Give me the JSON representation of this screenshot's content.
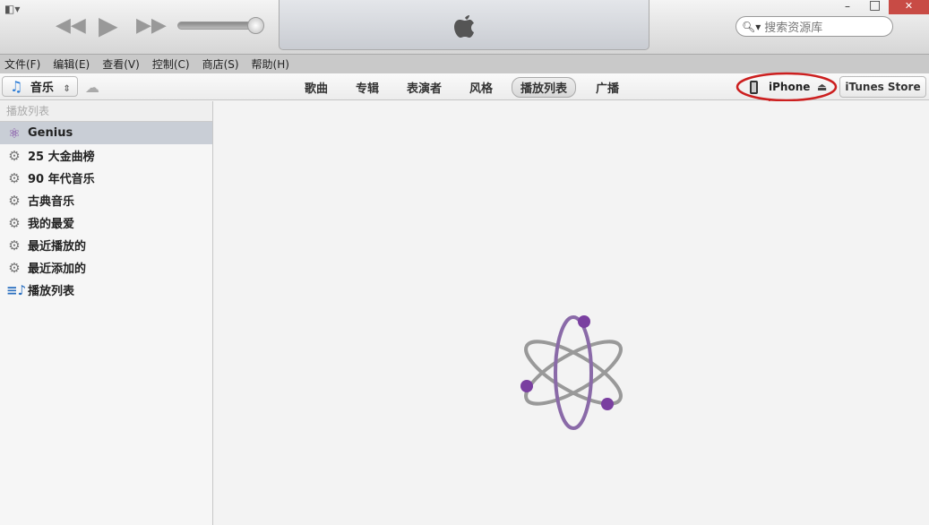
{
  "window": {
    "logo": "apple-logo",
    "minimize": "–",
    "maximize": "□",
    "close": "✕"
  },
  "search": {
    "placeholder": "搜索资源库"
  },
  "menu": [
    "文件(F)",
    "编辑(E)",
    "查看(V)",
    "控制(C)",
    "商店(S)",
    "帮助(H)"
  ],
  "library": {
    "label": "音乐"
  },
  "nav_tabs": [
    "歌曲",
    "专辑",
    "表演者",
    "风格",
    "播放列表",
    "广播"
  ],
  "active_tab": "播放列表",
  "device": {
    "label": "iPhone"
  },
  "store": {
    "label": "iTunes Store"
  },
  "sidebar": {
    "header": "播放列表",
    "items": [
      {
        "label": "Genius",
        "icon": "genius-icon",
        "selected": true
      },
      {
        "label": "25 大金曲榜",
        "icon": "gear-icon"
      },
      {
        "label": "90 年代音乐",
        "icon": "gear-icon"
      },
      {
        "label": "古典音乐",
        "icon": "gear-icon"
      },
      {
        "label": "我的最爱",
        "icon": "gear-icon"
      },
      {
        "label": "最近播放的",
        "icon": "gear-icon"
      },
      {
        "label": "最近添加的",
        "icon": "gear-icon"
      },
      {
        "label": "播放列表",
        "icon": "playlist-icon"
      }
    ]
  },
  "colors": {
    "annotation": "#cc1f1f",
    "genius": "#7a3fa0"
  }
}
